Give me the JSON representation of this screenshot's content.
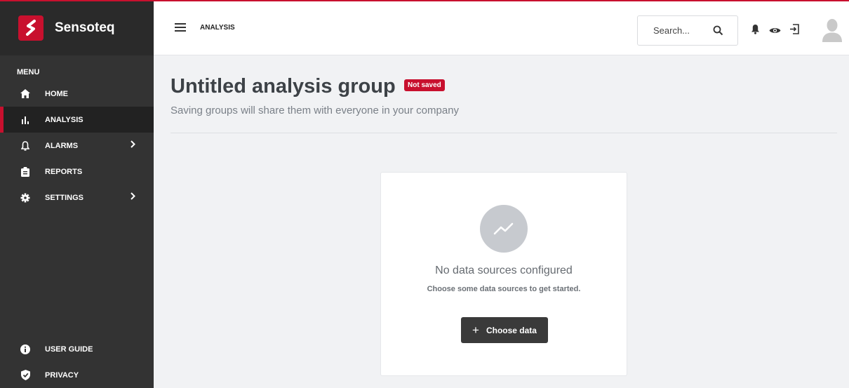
{
  "brand": {
    "name": "Sensoteq",
    "accent_color": "#c8102e"
  },
  "sidebar": {
    "menu_heading": "MENU",
    "items": [
      {
        "label": "HOME",
        "icon": "home-icon"
      },
      {
        "label": "ANALYSIS",
        "icon": "bar-chart-icon",
        "active": true
      },
      {
        "label": "ALARMS",
        "icon": "bell-outline-icon",
        "has_submenu": true
      },
      {
        "label": "REPORTS",
        "icon": "clipboard-icon"
      },
      {
        "label": "SETTINGS",
        "icon": "gear-icon",
        "has_submenu": true
      }
    ],
    "bottom_items": [
      {
        "label": "USER GUIDE",
        "icon": "info-icon"
      },
      {
        "label": "PRIVACY",
        "icon": "shield-check-icon"
      }
    ]
  },
  "topbar": {
    "title": "ANALYSIS",
    "search_placeholder": "Search...",
    "icons": [
      "search-icon",
      "bell-icon",
      "eye-icon",
      "logout-icon",
      "avatar-icon"
    ]
  },
  "main": {
    "title": "Untitled analysis group",
    "badge": "Not saved",
    "subtitle": "Saving groups will share them with everyone in your company",
    "empty_state": {
      "icon": "trending-line-icon",
      "title": "No data sources configured",
      "subtitle": "Choose some data sources to get started.",
      "button_label": "Choose data"
    }
  }
}
